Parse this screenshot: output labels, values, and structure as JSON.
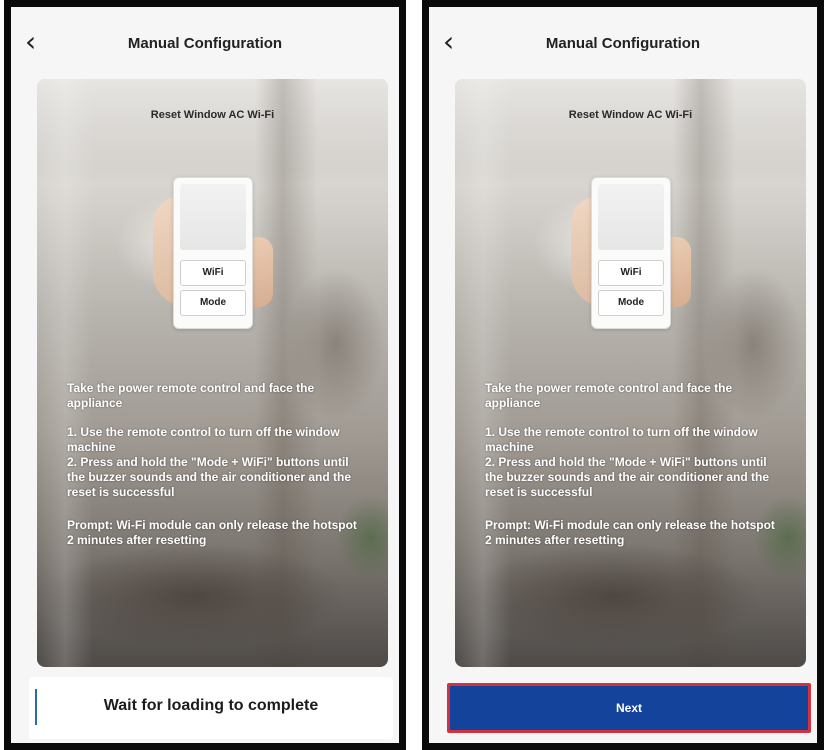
{
  "left_screen": {
    "header": {
      "title": "Manual Configuration",
      "back_icon": "chevron-left-icon"
    },
    "card": {
      "title": "Reset Window AC Wi-Fi",
      "remote_buttons": [
        "WiFi",
        "Mode"
      ],
      "intro": "Take the power remote control and face the appliance",
      "step1": "1. Use the remote control to turn off the window machine",
      "step2": "2. Press and hold the \"Mode + WiFi\" buttons until the buzzer sounds and the air conditioner and the reset is successful",
      "prompt": "Prompt: Wi-Fi module can only release the hotspot 2 minutes after resetting"
    },
    "footer": {
      "status_text": "Wait for loading to complete"
    }
  },
  "right_screen": {
    "header": {
      "title": "Manual Configuration",
      "back_icon": "chevron-left-icon"
    },
    "card": {
      "title": "Reset Window AC Wi-Fi",
      "remote_buttons": [
        "WiFi",
        "Mode"
      ],
      "intro": "Take the power remote control and face the appliance",
      "step1": "1. Use the remote control to turn off the window machine",
      "step2": "2. Press and hold the \"Mode + WiFi\" buttons until the buzzer sounds and the air conditioner and the reset is successful",
      "prompt": "Prompt: Wi-Fi module can only release the hotspot 2 minutes after resetting"
    },
    "footer": {
      "button_label": "Next",
      "button_color": "#13439a",
      "highlight_border": "#d2323f"
    }
  }
}
